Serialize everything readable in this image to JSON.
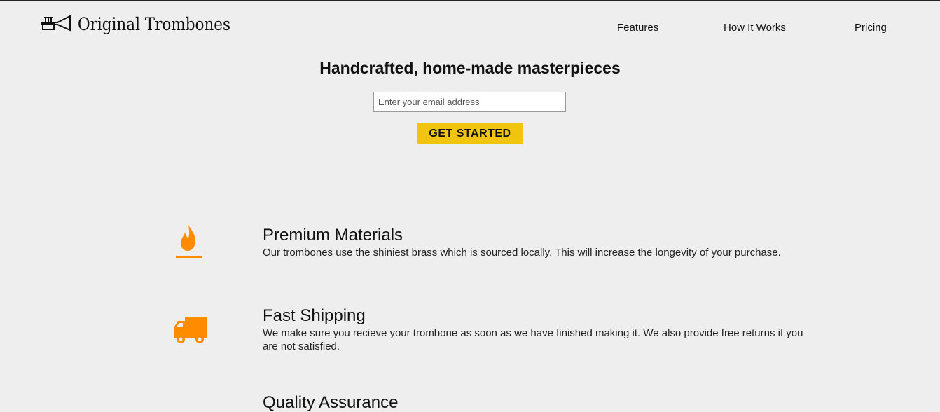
{
  "header": {
    "brand": "Original Trombones",
    "logo_icon": "trumpet-icon",
    "nav": {
      "features": "Features",
      "how_it_works": "How It Works",
      "pricing": "Pricing"
    }
  },
  "hero": {
    "title": "Handcrafted, home-made masterpieces",
    "email_placeholder": "Enter your email address",
    "cta_label": "GET STARTED"
  },
  "features": [
    {
      "icon": "fire-icon",
      "title": "Premium Materials",
      "text": "Our trombones use the shiniest brass which is sourced locally. This will increase the longevity of your purchase."
    },
    {
      "icon": "truck-icon",
      "title": "Fast Shipping",
      "text": "We make sure you recieve your trombone as soon as we have finished making it. We also provide free returns if you are not satisfied."
    },
    {
      "title": "Quality Assurance"
    }
  ],
  "colors": {
    "background": "#eeeeee",
    "accent_orange": "#ff8c00",
    "cta_yellow": "#f1c40f"
  }
}
